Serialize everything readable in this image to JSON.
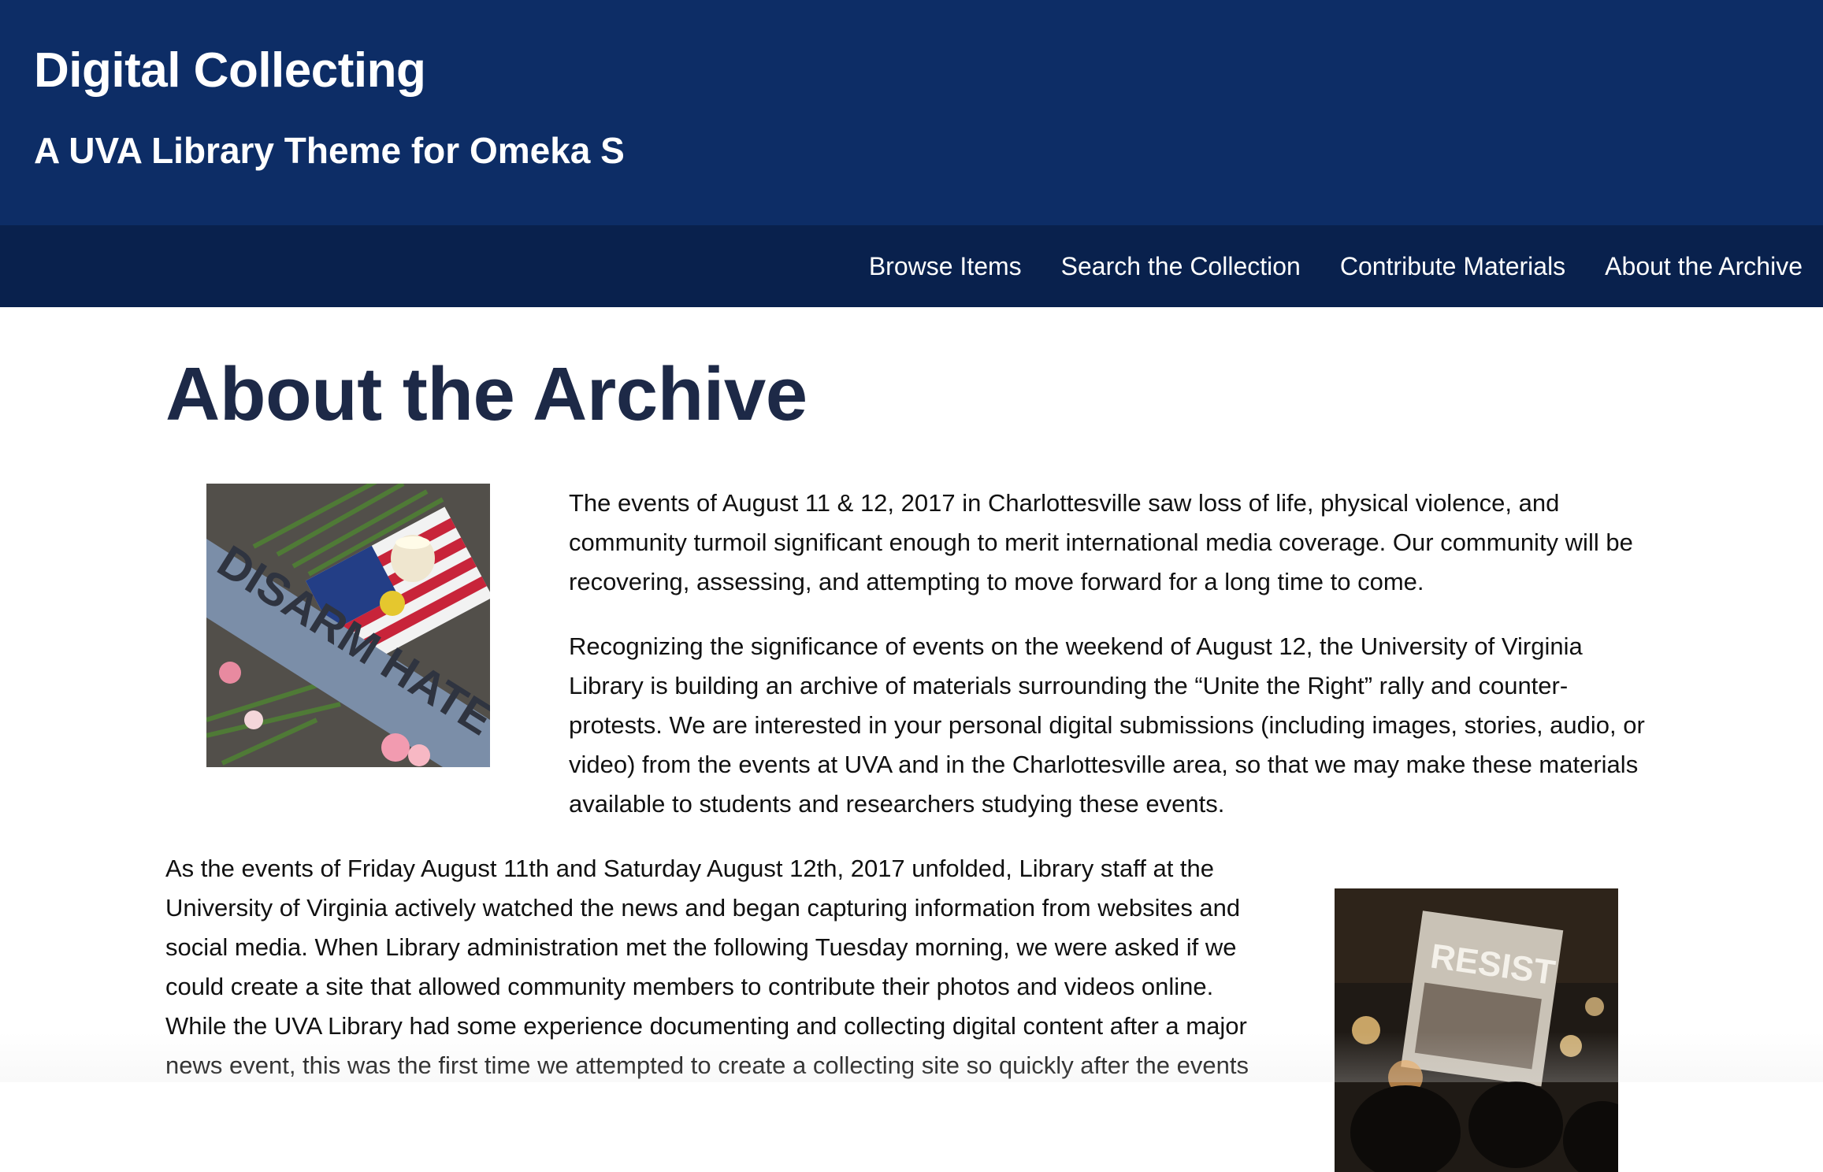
{
  "header": {
    "site_title": "Digital Collecting",
    "site_subtitle": "A UVA Library Theme for Omeka S",
    "background_color": "#0d2d66"
  },
  "nav": {
    "background_color": "#09214d",
    "items": [
      {
        "label": "Browse Items"
      },
      {
        "label": "Search the Collection"
      },
      {
        "label": "Contribute Materials"
      },
      {
        "label": "About the Archive"
      }
    ]
  },
  "main": {
    "page_title": "About the Archive",
    "title_color": "#1d2947",
    "images": [
      {
        "name": "memorial-photo",
        "text_in_image": "DISARM HATE"
      },
      {
        "name": "resist-protest-photo",
        "text_in_image": "RESIST"
      }
    ],
    "paragraphs": [
      "The events of August 11 & 12, 2017 in Charlottesville saw loss of life, physical violence, and community turmoil significant enough to merit international media coverage. Our community will be recovering, assessing, and attempting to move forward for a long time to come.",
      "Recognizing the significance of events on the weekend of August 12, the University of Virginia Library is building an archive of materials surrounding the “Unite the Right” rally and counter-protests. We are interested in your personal digital submissions (including images, stories, audio, or video) from the events at UVA and in the Charlottesville area, so that we may make these materials available to students and researchers studying these events.",
      "As the events of Friday August 11th and Saturday August 12th, 2017 unfolded, Library staff at the University of Virginia actively watched the news and began capturing information from websites and social media. When Library administration met the following Tuesday morning, we were asked if we could create a site that allowed community members to contribute their photos and videos online. While the UVA Library had some experience documenting and collecting digital content after a major news event, this was the first time we attempted to create a collecting site so quickly after the events"
    ]
  }
}
